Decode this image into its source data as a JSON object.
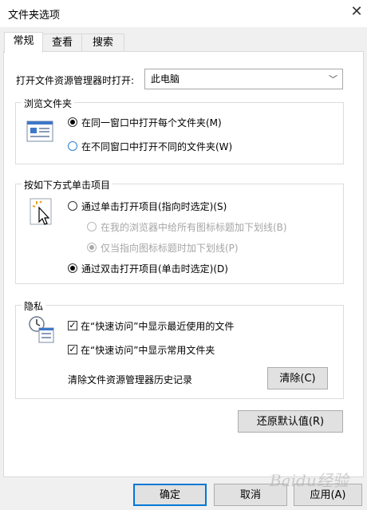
{
  "window": {
    "title": "文件夹选项",
    "close_glyph": "✕"
  },
  "tabs": [
    {
      "label": "常规",
      "active": true
    },
    {
      "label": "查看",
      "active": false
    },
    {
      "label": "搜索",
      "active": false
    }
  ],
  "open_explorer": {
    "label": "打开文件资源管理器时打开:",
    "value": "此电脑"
  },
  "browse_folders": {
    "title": "浏览文件夹",
    "options": [
      {
        "label": "在同一窗口中打开每个文件夹(M)",
        "checked": true
      },
      {
        "label": "在不同窗口中打开不同的文件夹(W)",
        "checked": false
      }
    ]
  },
  "click_items": {
    "title": "按如下方式单击项目",
    "single_click": {
      "label": "通过单击打开项目(指向时选定)(S)",
      "checked": false
    },
    "underline_all": {
      "label": "在我的浏览器中给所有图标标题加下划线(B)",
      "checked": false,
      "disabled": true
    },
    "underline_point": {
      "label": "仅当指向图标标题时加下划线(P)",
      "checked": true,
      "disabled": true
    },
    "double_click": {
      "label": "通过双击打开项目(单击时选定)(D)",
      "checked": true
    }
  },
  "privacy": {
    "title": "隐私",
    "show_recent": {
      "label": "在“快速访问”中显示最近使用的文件",
      "checked": true
    },
    "show_frequent": {
      "label": "在“快速访问”中显示常用文件夹",
      "checked": true
    },
    "clear_label": "清除文件资源管理器历史记录",
    "clear_button": "清除(C)"
  },
  "restore_defaults_button": "还原默认值(R)",
  "footer": {
    "ok": "确定",
    "cancel": "取消",
    "apply": "应用(A)"
  },
  "watermark": "Baidu经验",
  "colors": {
    "accent": "#0078d7",
    "radio_blue": "#2b7fd9",
    "disabled": "#a6a6a6"
  }
}
